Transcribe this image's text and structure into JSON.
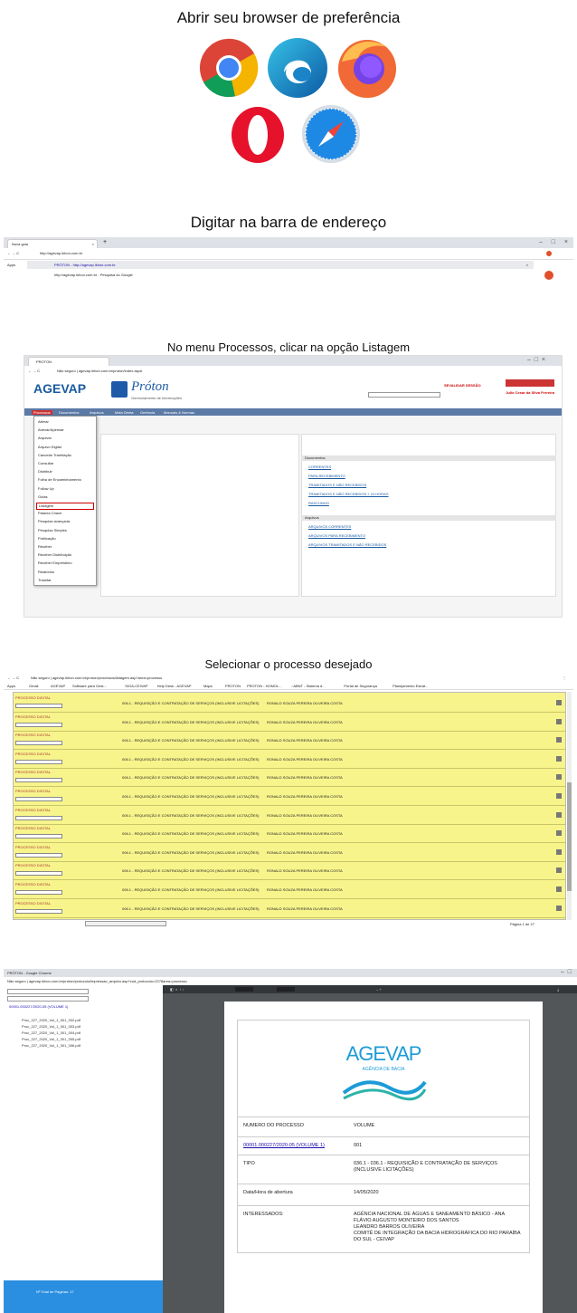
{
  "step1": {
    "title": "Abrir seu browser de preferência"
  },
  "step2": {
    "title": "Digitar na barra de endereço",
    "tab": "Nova guia",
    "url": "http://agevap.ikhon.com.br",
    "suggestion1": "PRÓTON - http://agevap.ikhon.com.br",
    "suggestion2": "http://agevap.ikhon.com.br - Pesquisa do Google",
    "apps": "Apps"
  },
  "step3": {
    "title": "No menu Processos, clicar na opção Listagem",
    "tab": "PROTON",
    "url": "Não seguro | agevap.ikhon.com.br/proton/index.asp#",
    "logo": "AGEVAP",
    "proton": "Próton",
    "proton_sub": "Gerenciamento de Informações",
    "session": "SEVALIDAR SESSÃO",
    "user": "Julio Cesar da Silva Ferreira",
    "menu_bar": [
      "Processos",
      "Documentos",
      "Arquivos",
      "Mala Direta",
      "Gerência",
      "Manuais & Normas"
    ],
    "menu": [
      "Alterar",
      "Anexar/Apensar",
      "Arquivar",
      "Arquivo Digital",
      "Cancelar Tramitação",
      "Consultar",
      "Distribuir",
      "Folha de Encaminhamento",
      "Follow Up",
      "Guias",
      "Listagem",
      "Palavra Chave",
      "Pesquisa avançada",
      "Pesquisa Simples",
      "Publicação",
      "Receber",
      "Receber Distribuição",
      "Receber Empréstimo",
      "Relatórios",
      "Tramitar"
    ],
    "highlight": "Listagem",
    "documentos_hdr": "Documentos",
    "documentos": [
      "CORRENTES",
      "PARA RECEBIMENTO",
      "TRAMITADOS E NÃO RECEBIDOS",
      "TRAMITADOS E NÃO RECEBIDOS + 24 HORAS",
      "RASCUNHO"
    ],
    "arquivos_hdr": "Arquivos",
    "arquivos": [
      "ARQUIVOS CORRENTES",
      "ARQUIVOS PARA RECEBIMENTO",
      "ARQUIVOS TRAMITADOS E NÃO RECEBIDOS"
    ]
  },
  "step4": {
    "title": "Selecionar o processo desejado",
    "url": "Não seguro | agevap.ikhon.com.br/proton/processos/listagem.asp?area=processo",
    "bookmarks": [
      "Apps",
      "Gmail",
      "AGEVAP",
      "Software para Gest...",
      "SIGA-CEIVAP",
      "Help Desk - AGEVAP",
      "Maps",
      "PROTON",
      "PROTON - HOMOL...",
      "::ABNT - Sistema d...",
      "Portal de Segurança",
      "Planejamento Estrat..."
    ],
    "row_label": "006.1 - REQUISIÇÃO E CONTRATAÇÃO DE SERVIÇOS (INCLUSIVE LICITAÇÕES)",
    "row_person": "RONALD SOUZA PEREIRA OLIVEIRA COSTA",
    "badge": "PROCESSO DIGITAL",
    "page": "Página 1 de 27"
  },
  "step5": {
    "window_title": "PRÓTON - Google Chrome",
    "url": "Não seguro | agevap.ikhon.com.br/proton/protocolo/impressao_arquivo.asp?cod_protocolo=2278area=processo",
    "tree_root": "00001.000227/2020-05 (VOLUME 1)",
    "tree_files": [
      "Proc_227_2020_Vol_1_001_002.pdf",
      "Proc_227_2020_Vol_1_001_003.pdf",
      "Proc_227_2020_Vol_1_001_004.pdf",
      "Proc_227_2020_Vol_1_001_005.pdf",
      "Proc_227_2020_Vol_1_001_006.pdf"
    ],
    "footer": "Nº Total de Páginas: 17",
    "doc_logo": "AGEVAP",
    "doc_logo_sub": "AGÊNCIA DE BACIA",
    "fields": [
      {
        "label": "NUMERO DO PROCESSO",
        "value": "VOLUME"
      },
      {
        "label": "00001.000227/2020-05 (VOLUME 1)",
        "value": "001"
      },
      {
        "label": "TIPO",
        "value": "036.1 - 036.1 - REQUISIÇÃO E CONTRATAÇÃO DE SERVIÇOS (INCLUSIVE LICITAÇÕES)"
      },
      {
        "label": "Data/Hora de abertura",
        "value": "14/05/2020"
      },
      {
        "label": "INTERESSADOS:",
        "value": "AGÊNCIA NACIONAL DE ÁGUAS E SANEAMENTO BÁSICO - ANA\nFLÁVIO AUGUSTO MONTEIRO DOS SANTOS\nLEANDRO BARROS OLIVEIRA\nCOMITÊ DE INTEGRAÇÃO DA BACIA HIDROGRÁFICA DO RIO PARAÍBA DO SUL - CEIVAP"
      }
    ]
  }
}
